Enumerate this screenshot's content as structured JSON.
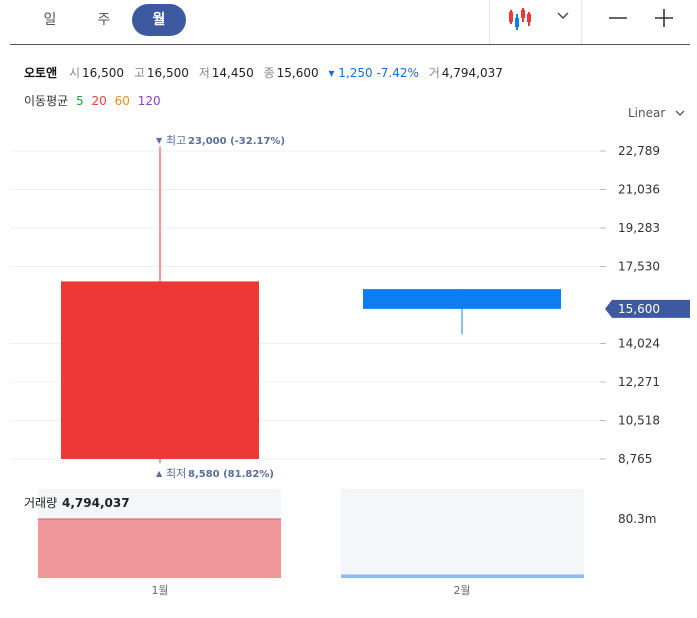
{
  "tabs": [
    {
      "label": "일",
      "active": false
    },
    {
      "label": "주",
      "active": false
    },
    {
      "label": "월",
      "active": true
    }
  ],
  "info": {
    "name": "오토앤",
    "open_label": "시",
    "open": "16,500",
    "high_label": "고",
    "high": "16,500",
    "low_label": "저",
    "low": "14,450",
    "close_label": "종",
    "close": "15,600",
    "change": "▾ 1,250 -7.42%",
    "volume_label": "거",
    "volume": "4,794,037"
  },
  "moving_average": {
    "label": "이동평균",
    "periods": [
      {
        "value": "5",
        "color": "#2e9d3a"
      },
      {
        "value": "20",
        "color": "#e8473a"
      },
      {
        "value": "60",
        "color": "#f08a24"
      },
      {
        "value": "120",
        "color": "#8a3fc7"
      }
    ]
  },
  "scale": {
    "label": "Linear"
  },
  "colors": {
    "up": "#ee3838",
    "down": "#0d7df0",
    "accent": "#3d5aa0",
    "volume_up": "#f0979b",
    "volume_down": "#8bbcec"
  },
  "chart_data": {
    "type": "candlestick",
    "categories": [
      "1월",
      "2월"
    ],
    "candles": [
      {
        "open": 8765,
        "high": 23000,
        "low": 8580,
        "close": 16850
      },
      {
        "open": 16500,
        "high": 16500,
        "low": 14450,
        "close": 15600
      }
    ],
    "ylim": [
      8765,
      22789
    ],
    "y_ticks": [
      "22,789",
      "21,036",
      "19,283",
      "17,530",
      "14,024",
      "12,271",
      "10,518",
      "8,765"
    ],
    "y_tick_values": [
      22789,
      21036,
      19283,
      17530,
      14024,
      12271,
      10518,
      8765
    ],
    "current_price": 15600,
    "current_price_label": "15,600",
    "high_annotation": {
      "prefix": "최고",
      "text": "23,000 (-32.17%)"
    },
    "low_annotation": {
      "prefix": "최저",
      "text": "8,580 (81.82%)"
    },
    "volume": {
      "label": "거래량",
      "value_label": "4,794,037",
      "values": [
        80300000,
        4794037
      ],
      "axis_label": "80.3m",
      "ylim": [
        0,
        80300000
      ]
    }
  }
}
